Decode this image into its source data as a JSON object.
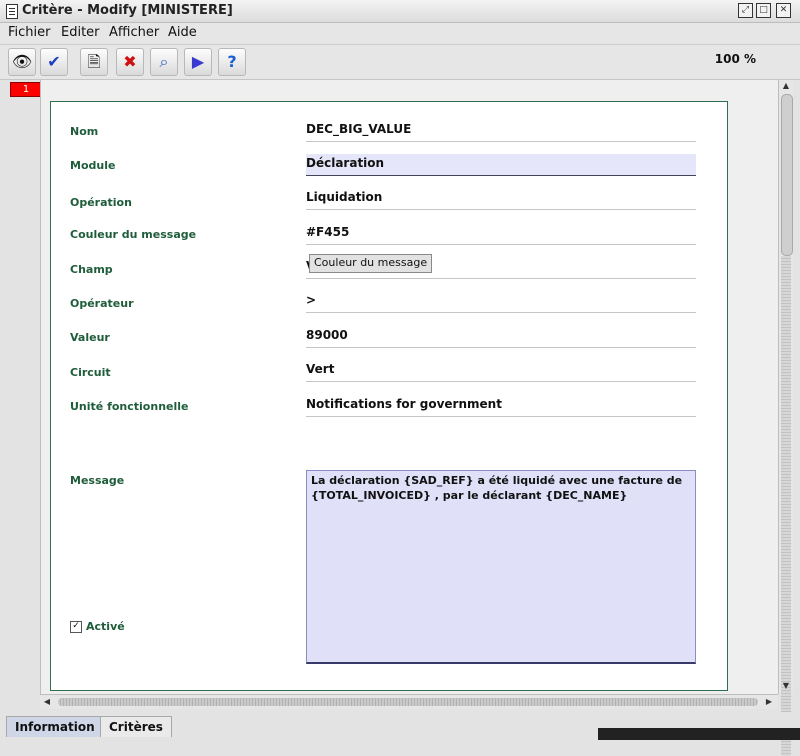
{
  "window": {
    "title": "Critère - Modify [MINISTERE]"
  },
  "menu": [
    "Fichier",
    "Editer",
    "Afficher",
    "Aide"
  ],
  "toolbar": {
    "zoom": "100 %"
  },
  "page_tab": "1",
  "form": {
    "nom": {
      "label": "Nom",
      "value": "DEC_BIG_VALUE"
    },
    "module": {
      "label": "Module",
      "value": "Déclaration"
    },
    "operation": {
      "label": "Opération",
      "value": "Liquidation"
    },
    "couleur": {
      "label": "Couleur du message",
      "value": "#F455"
    },
    "champ": {
      "label": "Champ",
      "value": "V"
    },
    "operateur": {
      "label": "Opérateur",
      "value": ">"
    },
    "valeur": {
      "label": "Valeur",
      "value": "89000"
    },
    "circuit": {
      "label": "Circuit",
      "value": "Vert"
    },
    "unite": {
      "label": "Unité fonctionnelle",
      "value": "Notifications for government"
    },
    "message": {
      "label": "Message",
      "value": "La déclaration {SAD_REF} a été liquidé avec une facture de {TOTAL_INVOICED} , par le déclarant {DEC_NAME}"
    },
    "active": {
      "label": "Activé",
      "checked": true
    }
  },
  "tooltip": "Couleur du message",
  "bottom_tabs": [
    "Information",
    "Critères"
  ]
}
